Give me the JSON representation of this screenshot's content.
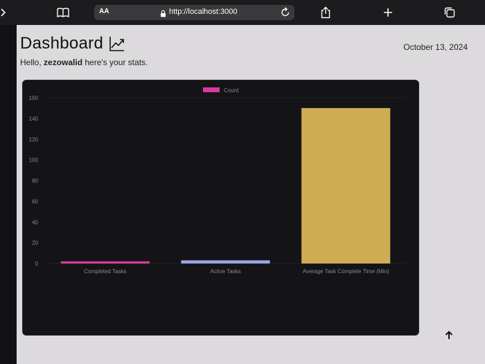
{
  "browser": {
    "aa_label": "AA",
    "url": "http://localhost:3000"
  },
  "header": {
    "title": "Dashboard",
    "date": "October 13, 2024",
    "greeting_prefix": "Hello, ",
    "username": "zezowalid",
    "greeting_suffix": " here's your stats."
  },
  "colors": {
    "completed": "#d63aa0",
    "active": "#9aa6e8",
    "average": "#cfac52",
    "card_bg": "#141416",
    "page_bg": "#dcdadc"
  },
  "chart_data": {
    "type": "bar",
    "categories": [
      "Completed Tasks",
      "Active Tasks",
      "Average Task Complete Time (Min)"
    ],
    "series": [
      {
        "name": "Count",
        "values": [
          2,
          3,
          150
        ]
      }
    ],
    "ylim": [
      0,
      160
    ],
    "yticks": [
      "0",
      "20",
      "40",
      "60",
      "80",
      "100",
      "120",
      "140",
      "160"
    ],
    "legend": "top"
  }
}
